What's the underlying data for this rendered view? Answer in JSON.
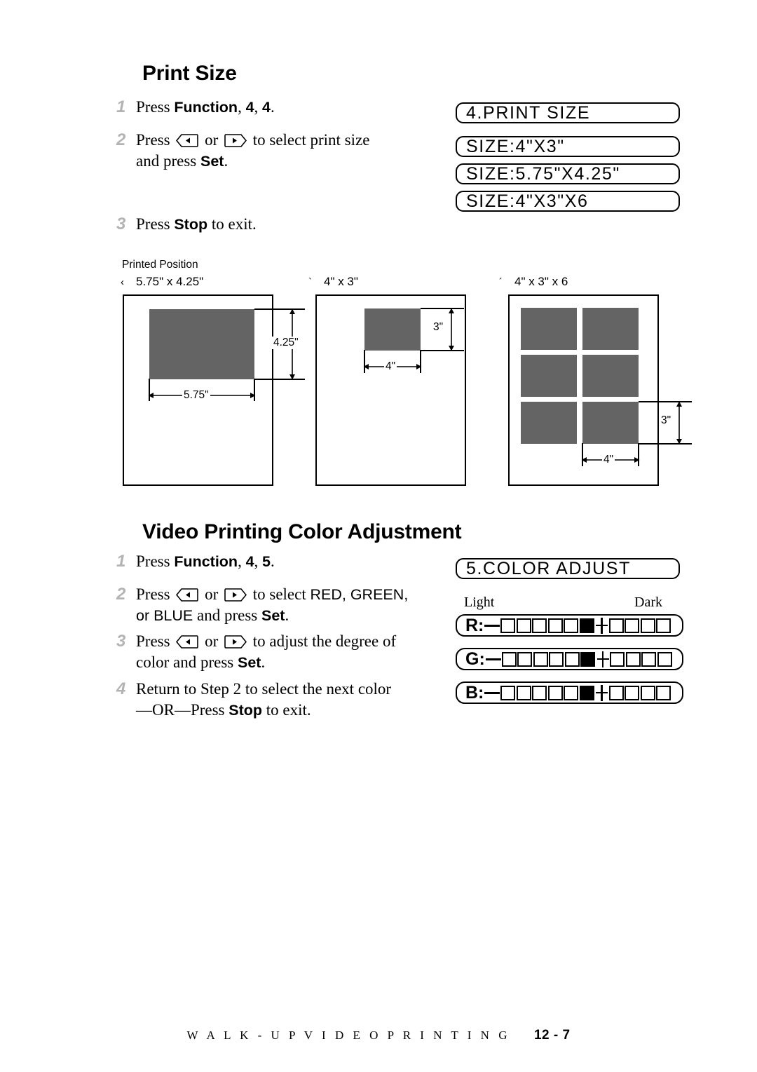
{
  "sections": [
    {
      "heading": "Print Size",
      "steps": [
        {
          "num": "1",
          "prefix": "Press ",
          "bold1": "Function",
          "mid": ", ",
          "bold2": "4",
          "mid2": ", ",
          "bold3": "4",
          "suffix": "."
        },
        {
          "num": "2",
          "line1_a": "Press ",
          "line1_b": " or ",
          "line1_c": " to select print size",
          "line2_a": "and press ",
          "line2_bold": "Set",
          "line2_b": "."
        },
        {
          "num": "3",
          "prefix": "Press ",
          "bold1": "Stop",
          "suffix": " to exit."
        }
      ]
    },
    {
      "heading": "Video Printing Color Adjustment",
      "steps": [
        {
          "num": "1",
          "prefix": "Press ",
          "bold1": "Function",
          "mid": ", ",
          "bold2": "4",
          "mid2": ", ",
          "bold3": "5",
          "suffix": "."
        },
        {
          "num": "2",
          "line1_a": "Press ",
          "line1_b": " or ",
          "line1_c": " to select ",
          "line1_sans": "RED, GREEN,",
          "line2_sans": "or BLUE",
          "line2_a": " and press ",
          "line2_bold": "Set",
          "line2_b": "."
        },
        {
          "num": "3",
          "line1_a": "Press ",
          "line1_b": " or ",
          "line1_c": " to adjust the degree of",
          "line2_a": "color and press ",
          "line2_bold": "Set",
          "line2_b": "."
        },
        {
          "num": "4",
          "line1": "Return to Step 2 to select the next color",
          "line2_a": "—OR—Press ",
          "line2_bold": "Stop",
          "line2_b": " to exit."
        }
      ]
    }
  ],
  "lcd_print_size": {
    "title": "4.PRINT SIZE",
    "options": [
      "SIZE:4\"X3\"",
      "SIZE:5.75\"X4.25\"",
      "SIZE:4\"X3\"X6"
    ]
  },
  "lcd_color_adjust": {
    "title": "5.COLOR ADJUST",
    "light_label": "Light",
    "dark_label": "Dark",
    "bars": [
      {
        "letter": "R:",
        "cells_before": 5,
        "filled": 1,
        "cells_after": 4
      },
      {
        "letter": "G:",
        "cells_before": 5,
        "filled": 1,
        "cells_after": 4
      },
      {
        "letter": "B:",
        "cells_before": 5,
        "filled": 1,
        "cells_after": 4
      }
    ]
  },
  "printed_position": {
    "title": "Printed Position",
    "diagrams": [
      {
        "mark": "‹",
        "label": "5.75\" x 4.25\"",
        "width_dim": "5.75\"",
        "height_dim": "4.25\"",
        "layout": "single-large"
      },
      {
        "mark": "`",
        "label": "4\" x 3\"",
        "width_dim": "4\"",
        "height_dim": "3\"",
        "layout": "single-small"
      },
      {
        "mark": "´",
        "label": "4\" x 3\" x 6",
        "width_dim": "4\"",
        "height_dim": "3\"",
        "layout": "six-up"
      }
    ]
  },
  "footer": {
    "text": "W A L K - U P   V I D E O   P R I N T I N G",
    "page": "12 - 7"
  },
  "colors": {
    "patch_gray": "#646464",
    "step_number_gray": "#b3b3b3",
    "ink": "#000000"
  }
}
